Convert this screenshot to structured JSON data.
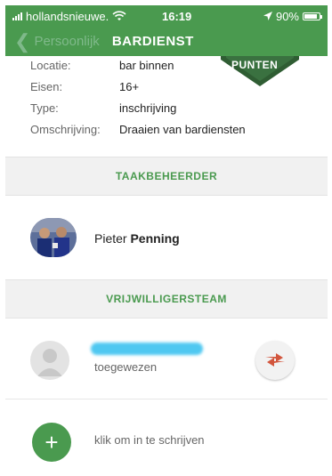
{
  "status_bar": {
    "carrier": "hollandsnieuwe.",
    "time": "16:19",
    "battery": "90%",
    "battery_level": 0.9
  },
  "nav": {
    "back_label": "Persoonlijk",
    "title": "BARDIENST"
  },
  "badge": {
    "label": "PUNTEN"
  },
  "details": [
    {
      "key": "Locatie:",
      "value": "bar binnen"
    },
    {
      "key": "Eisen:",
      "value": "16+"
    },
    {
      "key": "Type:",
      "value": "inschrijving"
    },
    {
      "key": "Omschrijving:",
      "value": "Draaien van bardiensten"
    }
  ],
  "taakbeheerder": {
    "heading": "TAAKBEHEERDER",
    "first_name": "Pieter",
    "last_name": "Penning"
  },
  "vrijwilligersteam": {
    "heading": "VRIJWILLIGERSTEAM",
    "assigned_status": "toegewezen",
    "signup_text": "klik om in te schrijven"
  },
  "colors": {
    "brand_green": "#4a9a4f",
    "swap_red": "#d2553c",
    "redaction_blue": "#4fc8f1"
  }
}
